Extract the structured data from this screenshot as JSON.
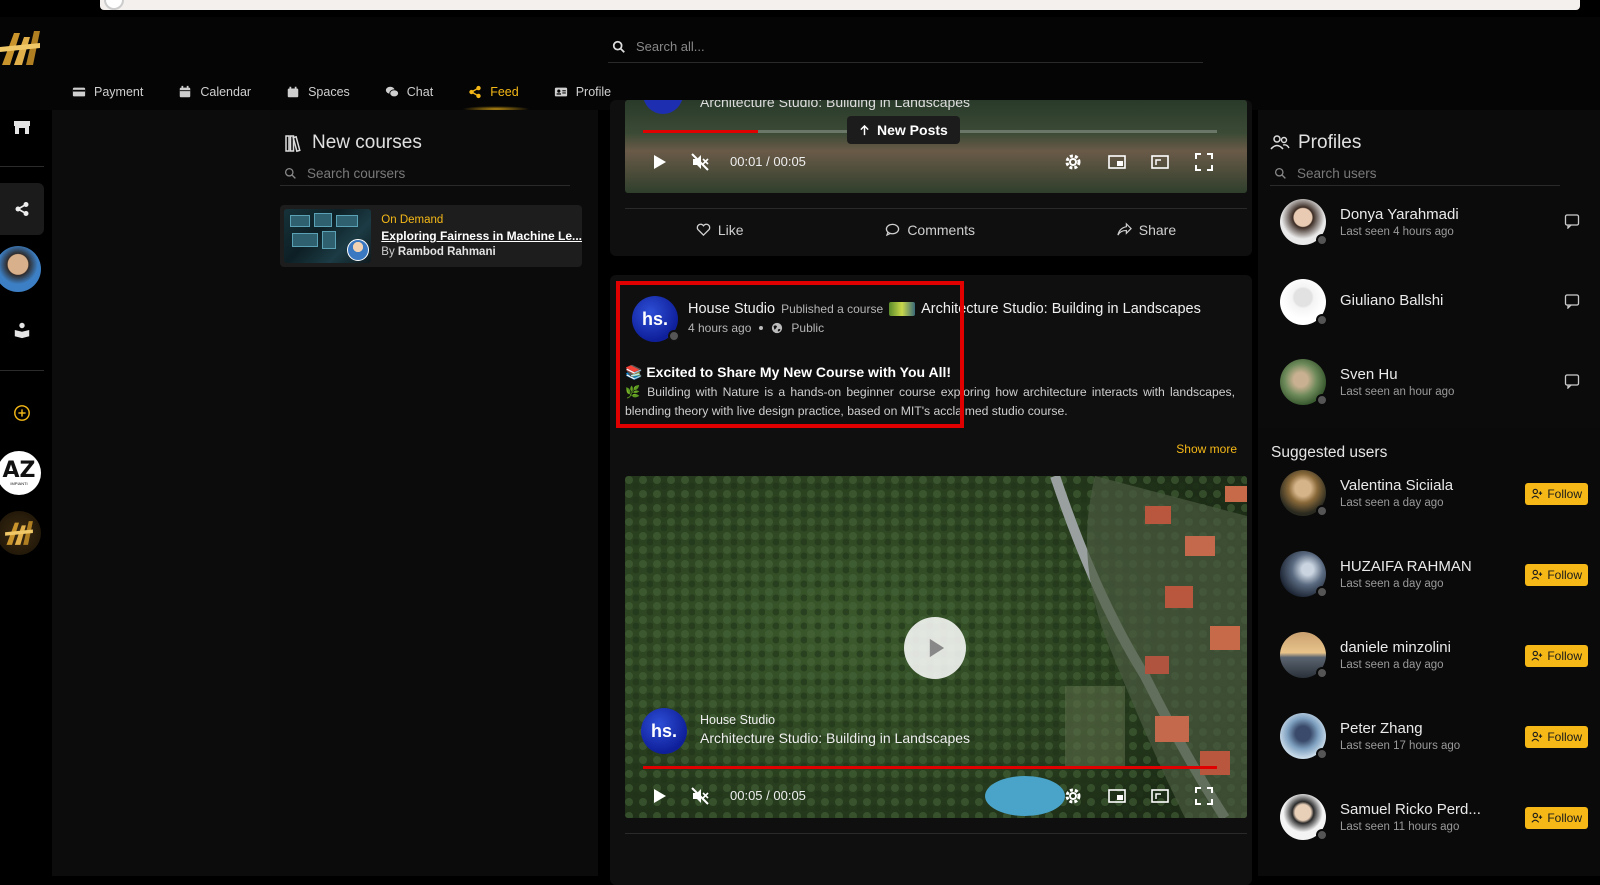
{
  "search": {
    "placeholder": "Search all..."
  },
  "nav": {
    "tabs": [
      {
        "label": "Payment",
        "icon": "credit-card-icon"
      },
      {
        "label": "Calendar",
        "icon": "calendar-icon"
      },
      {
        "label": "Spaces",
        "icon": "spaces-icon"
      },
      {
        "label": "Chat",
        "icon": "chat-icon"
      },
      {
        "label": "Feed",
        "icon": "share-icon",
        "active": true
      },
      {
        "label": "Profile",
        "icon": "id-card-icon"
      }
    ]
  },
  "left_rail": {
    "logo_text": "AZ",
    "logo_subtext": "IMPIANTI"
  },
  "courses": {
    "title": "New courses",
    "search_placeholder": "Search coursers",
    "items": [
      {
        "tag": "On Demand",
        "title": "Exploring Fairness in Machine Le...",
        "by_prefix": "By",
        "author": "Rambod Rahmani"
      }
    ]
  },
  "feed": {
    "new_posts_label": "New Posts",
    "top_video": {
      "overlay_title": "Architecture Studio: Building in Landscapes",
      "time": "00:01 / 00:05",
      "progress": 0.2
    },
    "top_actions": {
      "like": "Like",
      "comments": "Comments",
      "share": "Share"
    },
    "post": {
      "avatar_text": "hs.",
      "author": "House Studio",
      "action_text": "Published a course",
      "course_title": "Architecture Studio: Building in Landscapes",
      "time_ago": "4 hours ago",
      "visibility": "Public",
      "headline": "📚 Excited to Share My New Course with You All!",
      "body": "🌿 Building with Nature is a hands-on beginner course exploring how architecture interacts with landscapes, blending theory with live design practice, based on MIT's acclaimed studio course.",
      "show_more": "Show more"
    },
    "video": {
      "avatar_text": "hs.",
      "author": "House Studio",
      "title": "Architecture Studio: Building in Landscapes",
      "time": "00:05 / 00:05",
      "progress": 1.0
    }
  },
  "profiles": {
    "title": "Profiles",
    "search_placeholder": "Search users",
    "items": [
      {
        "name": "Donya Yarahmadi",
        "seen": "Last seen 4 hours ago"
      },
      {
        "name": "Giuliano Ballshi",
        "seen": ""
      },
      {
        "name": "Sven Hu",
        "seen": "Last seen an hour ago"
      }
    ],
    "suggested_title": "Suggested users",
    "follow_label": "Follow",
    "suggested": [
      {
        "name": "Valentina Siciiala",
        "seen": "Last seen a day ago"
      },
      {
        "name": "HUZAIFA RAHMAN",
        "seen": "Last seen a day ago"
      },
      {
        "name": "daniele minzolini",
        "seen": "Last seen a day ago"
      },
      {
        "name": "Peter Zhang",
        "seen": "Last seen 17 hours ago"
      },
      {
        "name": "Samuel Ricko Perd...",
        "seen": "Last seen 11 hours ago"
      }
    ]
  },
  "colors": {
    "accent": "#f5b817",
    "highlight_box": "#e00000",
    "progress": "#e00000"
  }
}
